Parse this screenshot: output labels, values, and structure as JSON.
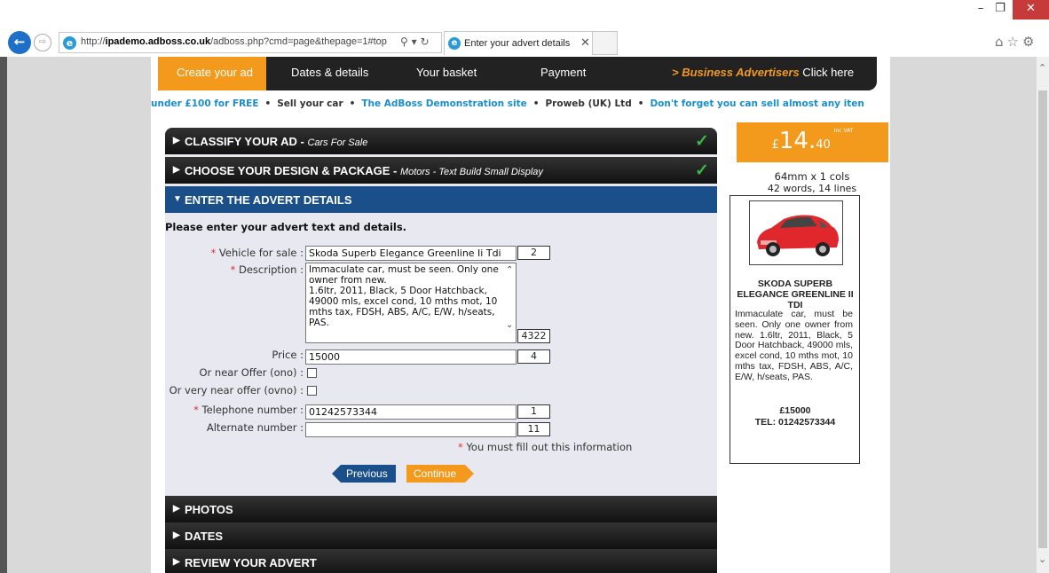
{
  "browser": {
    "url": "http://ipademo.adboss.co.uk/adboss.php?cmd=page&thepage=1#top",
    "url_host": "ipademo.adboss.co.uk",
    "url_prefix": "http://",
    "url_path": "/adboss.php?cmd=page&thepage=1#top",
    "tab_title": "Enter your advert details",
    "search_glyphs": "⚲ ▾ ↻",
    "window_buttons": [
      "–",
      "❐",
      "✕"
    ],
    "toolbar_icons": "⌂☆⚙"
  },
  "nav": {
    "items": [
      "Create your ad",
      "Dates & details",
      "Your basket",
      "Payment"
    ],
    "business_prefix": "> Business Advertisers",
    "business_suffix": " Click here"
  },
  "ticker": {
    "items": [
      "under £100 for FREE",
      "Sell your car",
      "The AdBoss Demonstration site",
      "Proweb (UK) Ltd",
      "Don't forget you can sell almost any iten"
    ],
    "sep": "•"
  },
  "sections": {
    "classify": {
      "title": "CLASSIFY YOUR AD - ",
      "sub": "Cars For Sale"
    },
    "design": {
      "title": "CHOOSE YOUR DESIGN & PACKAGE - ",
      "sub": "Motors - Text Build Small Display"
    },
    "enter": {
      "title": "ENTER THE ADVERT DETAILS"
    },
    "photos": {
      "title": "PHOTOS"
    },
    "dates": {
      "title": "DATES"
    },
    "review": {
      "title": "REVIEW YOUR ADVERT"
    }
  },
  "form": {
    "intro": "Please enter your advert text and details.",
    "vehicle_label": "Vehicle for sale :",
    "vehicle_value": "Skoda Superb Elegance Greenline Ii Tdi",
    "vehicle_count": "2",
    "desc_label": "Description :",
    "desc_value": "Immaculate car, must be seen. Only one owner from new.\n1.6ltr, 2011, Black, 5 Door Hatchback, 49000 mls, excel cond, 10 mths mot, 10 mths tax, FDSH, ABS, A/C, E/W, h/seats, PAS.",
    "desc_count": "4322",
    "price_label": "Price :",
    "price_value": "15000",
    "price_count": "4",
    "ono_label": "Or near Offer (ono) :",
    "ovno_label": "Or very near offer (ovno) :",
    "tel_label": "Telephone number :",
    "tel_value": "01242573344",
    "tel_count": "1",
    "alt_label": "Alternate number :",
    "alt_value": "",
    "alt_count": "11",
    "required_star": "*",
    "must_fill": "You must fill out this information",
    "prev_label": "Previous",
    "continue_label": "Continue"
  },
  "price_box": {
    "currency": "£",
    "main": "14.",
    "decimal": "40",
    "vat": "Inc VAT",
    "size": "64mm x 1 cols",
    "words": "42 words, 14 lines"
  },
  "preview": {
    "title": "SKODA SUPERB ELEGANCE GREENLINE II TDI",
    "text": "Immaculate car, must be seen. Only one owner from new. 1.6ltr, 2011, Black, 5 Door Hatchback, 49000 mls, excel cond, 10 mths mot, 10 mths tax, FDSH, ABS, A/C, E/W, h/seats, PAS.",
    "price": "£15000",
    "tel": "TEL: 01242573344"
  }
}
